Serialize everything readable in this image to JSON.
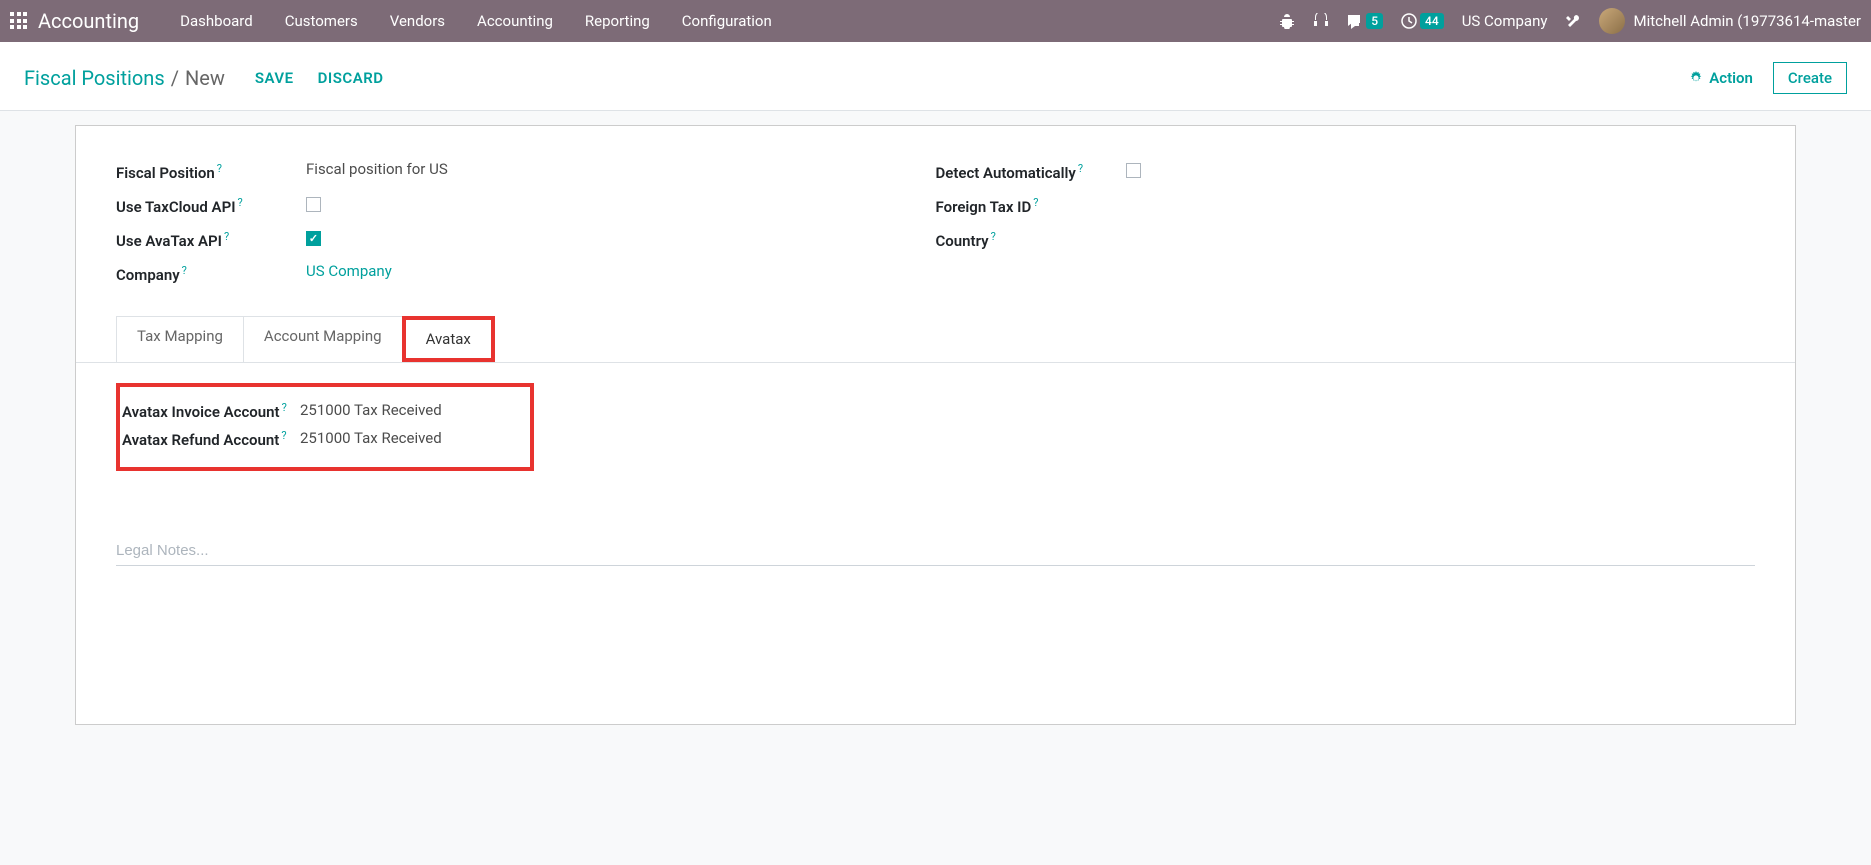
{
  "navbar": {
    "brand": "Accounting",
    "links": [
      "Dashboard",
      "Customers",
      "Vendors",
      "Accounting",
      "Reporting",
      "Configuration"
    ],
    "conversations_badge": "5",
    "activities_badge": "44",
    "company": "US Company",
    "user": "Mitchell Admin (19773614-master"
  },
  "control_panel": {
    "breadcrumb_root": "Fiscal Positions",
    "breadcrumb_current": "New",
    "save": "SAVE",
    "discard": "DISCARD",
    "action": "Action",
    "create": "Create"
  },
  "form": {
    "fiscal_position_label": "Fiscal Position",
    "fiscal_position_value": "Fiscal position for US",
    "use_taxcloud_label": "Use TaxCloud API",
    "use_avatax_label": "Use AvaTax API",
    "company_label": "Company",
    "company_value": "US Company",
    "detect_auto_label": "Detect Automatically",
    "foreign_tax_label": "Foreign Tax ID",
    "country_label": "Country"
  },
  "tabs": {
    "tax_mapping": "Tax Mapping",
    "account_mapping": "Account Mapping",
    "avatax": "Avatax"
  },
  "avatax": {
    "invoice_account_label": "Avatax Invoice Account",
    "invoice_account_value": "251000 Tax Received",
    "refund_account_label": "Avatax Refund Account",
    "refund_account_value": "251000 Tax Received"
  },
  "legal_notes_placeholder": "Legal Notes..."
}
